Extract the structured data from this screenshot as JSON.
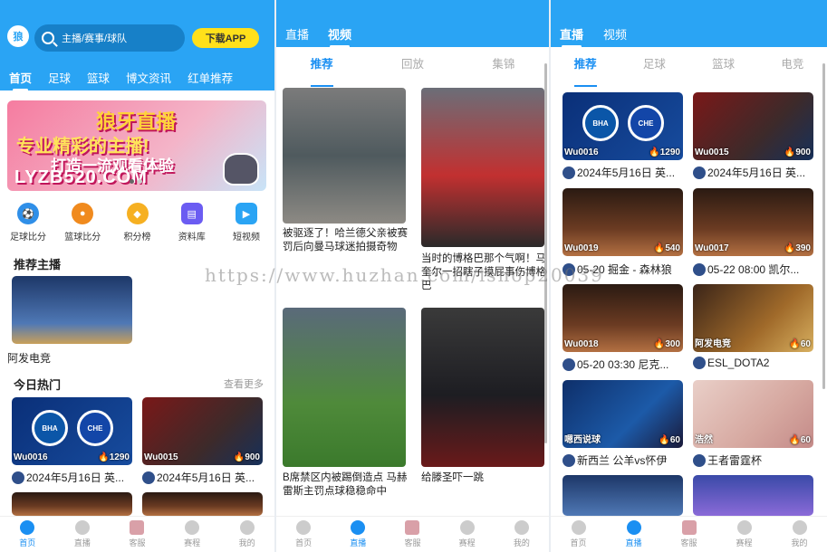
{
  "home": {
    "search_placeholder": "主播/赛事/球队",
    "download_label": "下载APP",
    "tabs": [
      "首页",
      "足球",
      "篮球",
      "博文资讯",
      "红单推荐"
    ],
    "banner": {
      "line1": "狼牙直播",
      "line2": "专业精彩的主播!",
      "line3": "打造一流观看体验",
      "line4": "LYZB520.COM"
    },
    "quick_links": [
      "足球比分",
      "篮球比分",
      "积分榜",
      "资料库",
      "短视频"
    ],
    "recommended_title": "推荐主播",
    "anchor_name": "阿发电竞",
    "hot_title": "今日热门",
    "more_label": "查看更多",
    "hot_cards": [
      {
        "room": "Wu0016",
        "heat": "1290",
        "caption": "2024年5月16日 英..."
      },
      {
        "room": "Wu0015",
        "heat": "900",
        "caption": "2024年5月16日 英..."
      }
    ]
  },
  "bottom_nav": [
    "首页",
    "直播",
    "客服",
    "赛程",
    "我的"
  ],
  "video_page": {
    "top_tabs": [
      "直播",
      "视频"
    ],
    "sub_tabs": [
      "推荐",
      "回放",
      "集锦"
    ],
    "videos": [
      {
        "title": "被驱逐了！哈兰德父亲被赛罚后向曼马球迷拍摄奇物"
      },
      {
        "title": "当时的博格巴那个气啊！马奎尔一招瞎子摸屁事伤博格巴"
      },
      {
        "title": "B席禁区内被踢倒造点 马赫雷斯主罚点球稳稳命中"
      },
      {
        "title": "给滕圣吓一跳"
      }
    ]
  },
  "live_page": {
    "top_tabs": [
      "直播",
      "视频"
    ],
    "sub_tabs": [
      "推荐",
      "足球",
      "篮球",
      "电竞"
    ],
    "cards": [
      {
        "room": "Wu0016",
        "heat": "1290",
        "caption": "2024年5月16日 英..."
      },
      {
        "room": "Wu0015",
        "heat": "900",
        "caption": "2024年5月16日 英..."
      },
      {
        "room": "Wu0019",
        "heat": "540",
        "caption": "05-20 掘金 - 森林狼"
      },
      {
        "room": "Wu0017",
        "heat": "390",
        "caption": "05-22 08:00 凯尔..."
      },
      {
        "room": "Wu0018",
        "heat": "300",
        "caption": "05-20 03:30 尼克..."
      },
      {
        "room": "阿发电竞",
        "heat": "60",
        "caption": "ESL_DOTA2"
      },
      {
        "room": "嗯西说球",
        "heat": "60",
        "caption": "新西兰 公羊vs怀伊"
      },
      {
        "room": "浩然",
        "heat": "60",
        "caption": "王者雷霆杯"
      }
    ]
  },
  "watermark": "https://www.huzhan.com/ishop20039",
  "colors": {
    "brand": "#2aa4f4",
    "accent": "#1a8ff2",
    "download": "#ffe01a"
  }
}
